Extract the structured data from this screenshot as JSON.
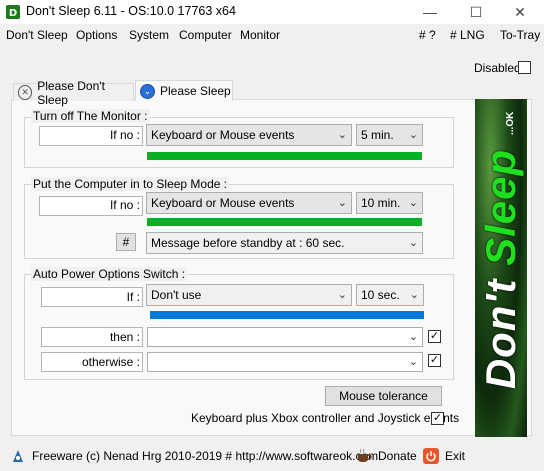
{
  "window": {
    "title": "Don't Sleep 6.11 - OS:10.0 17763 x64",
    "minimize": "—",
    "maximize": "☐",
    "close": "✕"
  },
  "menu": {
    "left": [
      "Don't Sleep",
      "Options",
      "System",
      "Computer",
      "Monitor"
    ],
    "right": [
      "# ?",
      "# LNG",
      "To-Tray"
    ]
  },
  "disabled_label": "Disabled",
  "tabs": [
    {
      "label": "Please Don't Sleep",
      "active": false
    },
    {
      "label": "Please Sleep",
      "active": true
    }
  ],
  "monitor_group": {
    "title": "Turn off The Monitor :",
    "condition_label": "If no :",
    "event": "Keyboard or Mouse events",
    "time": "5 min.",
    "progress": 1.0
  },
  "sleep_group": {
    "title": "Put the Computer in to Sleep Mode :",
    "condition_label": "If no :",
    "event": "Keyboard or Mouse events",
    "time": "10 min.",
    "progress": 1.0,
    "hash_button": "#",
    "message": "Message before standby at : 60 sec."
  },
  "power_group": {
    "title": "Auto Power Options Switch :",
    "if_label": "If :",
    "if_value": "Don't use",
    "if_time": "10 sec.",
    "progress": 1.0,
    "then_label": "then :",
    "then_checked": true,
    "otherwise_label": "otherwise :",
    "otherwise_checked": true
  },
  "mouse_tolerance_button": "Mouse tolerance",
  "xbox_label": "Keyboard plus Xbox controller and Joystick events",
  "xbox_checked": true,
  "banner_text": "Don't Sleep",
  "banner_small": "...OK",
  "footer": {
    "copyright": "Freeware (c) Nenad Hrg 2010-2019 # http://www.softwareok.com",
    "donate": "Donate",
    "exit": "Exit"
  },
  "check_mark": "✓",
  "arrow_glyph": "⌄",
  "colors": {
    "progress_green": "#06b025",
    "progress_blue": "#0078d7",
    "banner_green": "#1fe01f"
  }
}
